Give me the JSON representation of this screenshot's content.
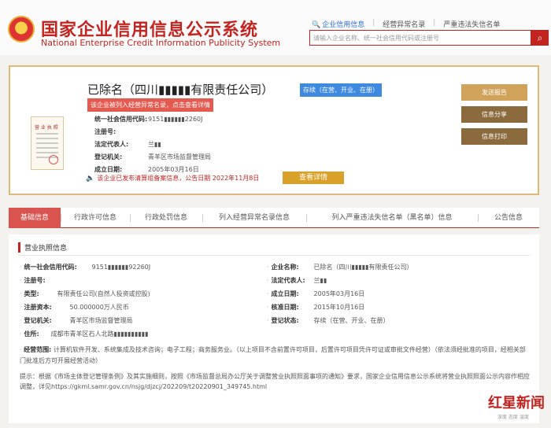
{
  "header": {
    "title": "国家企业信用信息公示系统",
    "subtitle": "National Enterprise Credit Information Publicity System",
    "search_tabs": [
      "企业信用信息",
      "经营异常名录",
      "严重违法失信名单"
    ],
    "search_placeholder": "请输入企业名称、统一社会信用代码或注册号"
  },
  "company": {
    "name": "已除名（四川▮▮▮▮▮有限责任公司）",
    "status": "存续（在营、开业、在册）",
    "warning": "该企业被列入经营异常名录，点击查看详情",
    "credit_code_label": "统一社会信用代码:",
    "credit_code": "9151▮▮▮▮▮▮2260J",
    "reg_no_label": "注册号:",
    "reg_no": "",
    "legal_rep_label": "法定代表人:",
    "legal_rep": "兰▮▮",
    "authority_label": "登记机关:",
    "authority": "青羊区市场监督管理局",
    "found_label": "成立日期:",
    "found_date": "2005年03月16日",
    "notice": "该企业已发布清算组备案信息，公告日期 2022年11月8日",
    "detail_btn": "查看详情",
    "license_caption": "营 业 执 照"
  },
  "side_buttons": {
    "report": "发送报告",
    "share": "信息分享",
    "print": "信息打印"
  },
  "tabs": [
    "基础信息",
    "行政许可信息",
    "行政处罚信息",
    "列入经营异常名录信息",
    "列入严重违法失信名单（黑名单）信息",
    "公告信息"
  ],
  "details": {
    "section_title": "营业执照信息",
    "fields": {
      "credit_code_label": "统一社会信用代码:",
      "credit_code": "9151▮▮▮▮▮▮92260J",
      "name_label": "企业名称:",
      "name": "已除名（四川▮▮▮▮▮有限责任公司）",
      "reg_no_label": "注册号:",
      "reg_no": "",
      "legal_rep_label": "法定代表人:",
      "legal_rep": "兰▮▮",
      "type_label": "类型:",
      "type": "有限责任公司(自然人投资或控股)",
      "found_label": "成立日期:",
      "found": "2005年03月16日",
      "capital_label": "注册资本:",
      "capital": "50.000000万人民币",
      "approve_label": "核准日期:",
      "approve": "2015年10月16日",
      "authority_label": "登记机关:",
      "authority": "青羊区市场监督管理局",
      "state_label": "登记状态:",
      "state": "存续（在营、开业、在册）",
      "address_label": "住所:",
      "address": "成都市青羊区石人北路▮▮▮▮▮▮▮▮▮▮"
    },
    "scope_label": "经营范围:",
    "scope": "计算机软件开发、系统集成及技术咨询；电子工程；商务服务业。（以上项目不含前置许可项目，后置许可项目凭许可证或审批文件经营）（依法须经批准的项目，经相关部门批准后方可开展经营活动）",
    "tip": "提示：根据《市场主体登记管理条例》及其实施细则，按照《市场监督总局办公厅关于调整营业执照照面事项的通知》要求，国家企业信用信息公示系统将营业执照照面公示内容作相应调整，详见https://gkml.samr.gov.cn/nsjg/djzcj/202209/t20220901_349745.html"
  },
  "watermark": {
    "text": "红星新闻",
    "sub": "深度 态度 温度"
  }
}
